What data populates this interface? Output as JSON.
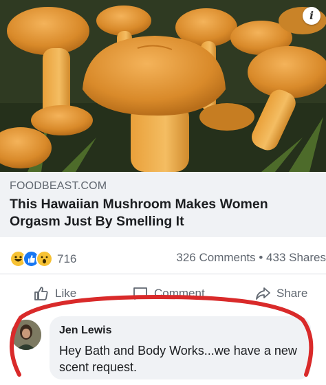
{
  "post": {
    "source": "FOODBEAST.COM",
    "headline": "This Hawaiian Mushroom Makes Women Orgasm Just By Smelling It",
    "info_icon": "i"
  },
  "stats": {
    "reaction_count": "716",
    "comments_shares": "326 Comments • 433 Shares"
  },
  "actions": {
    "like": "Like",
    "comment": "Comment",
    "share": "Share"
  },
  "comment": {
    "author": "Jen Lewis",
    "text": "Hey Bath and Body Works...we have a new scent request."
  },
  "colors": {
    "accent_red": "#d92a2a",
    "mushroom_orange": "#e39a3a",
    "facebook_blue": "#1877f2"
  }
}
